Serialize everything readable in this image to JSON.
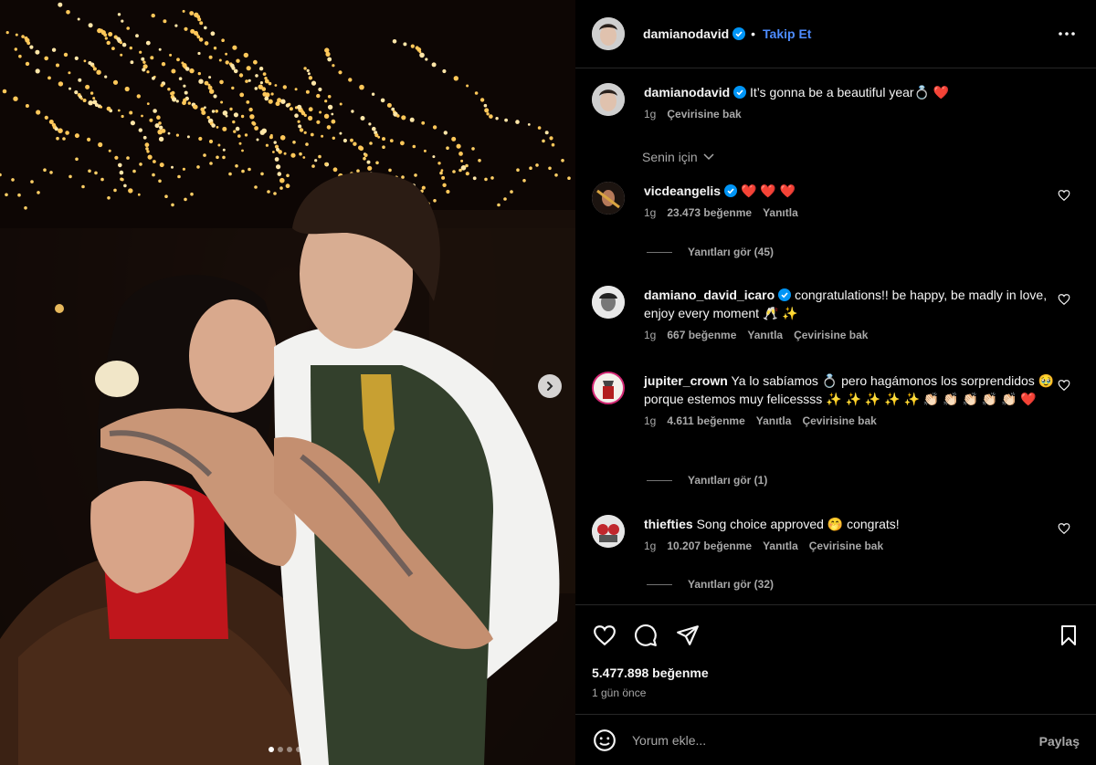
{
  "post": {
    "username": "damianodavid",
    "separator": "•",
    "follow_label": "Takip Et",
    "more_icon": "more-horizontal-icon"
  },
  "caption": {
    "username": "damianodavid",
    "text": "It’s gonna be a beautiful year💍 ❤️",
    "time": "1g",
    "translate": "Çevirisine bak"
  },
  "for_you": "Senin için",
  "comments": [
    {
      "username": "vicdeangelis",
      "verified": true,
      "text": "❤️ ❤️ ❤️",
      "time": "1g",
      "likes": "23.473 beğenme",
      "reply": "Yanıtla",
      "replies": "Yanıtları gör (45)"
    },
    {
      "username": "damiano_david_icaro",
      "verified": true,
      "text": "congratulations!! be happy, be madly in love, enjoy every moment 🥂 ✨",
      "time": "1g",
      "likes": "667 beğenme",
      "reply": "Yanıtla",
      "translate": "Çevirisine bak"
    },
    {
      "username": "jupiter_crown",
      "verified": false,
      "text": "Ya lo sabíamos 💍 pero hagámonos los sorprendidos 🥹 porque estemos muy felicessss ✨ ✨ ✨ ✨ ✨ 👏🏻 👏🏻 👏🏻 👏🏻 👏🏻 ❤️",
      "time": "1g",
      "likes": "4.611 beğenme",
      "reply": "Yanıtla",
      "translate": "Çevirisine bak",
      "replies": "Yanıtları gör (1)"
    },
    {
      "username": "thiefties",
      "verified": false,
      "text": "Song choice approved 🤭 congrats!",
      "time": "1g",
      "likes": "10.207 beğenme",
      "reply": "Yanıtla",
      "translate": "Çevirisine bak",
      "replies": "Yanıtları gör (32)"
    }
  ],
  "footer": {
    "likes": "5.477.898 beğenme",
    "ago": "1 gün önce",
    "comment_placeholder": "Yorum ekle...",
    "share_label": "Paylaş"
  },
  "carousel": {
    "slides": 4,
    "active": 0
  },
  "colors": {
    "background": "#000000",
    "follow_blue": "#4d8cff",
    "verified_blue": "#0095f6",
    "muted": "#a8a8a8",
    "divider": "#262626"
  }
}
